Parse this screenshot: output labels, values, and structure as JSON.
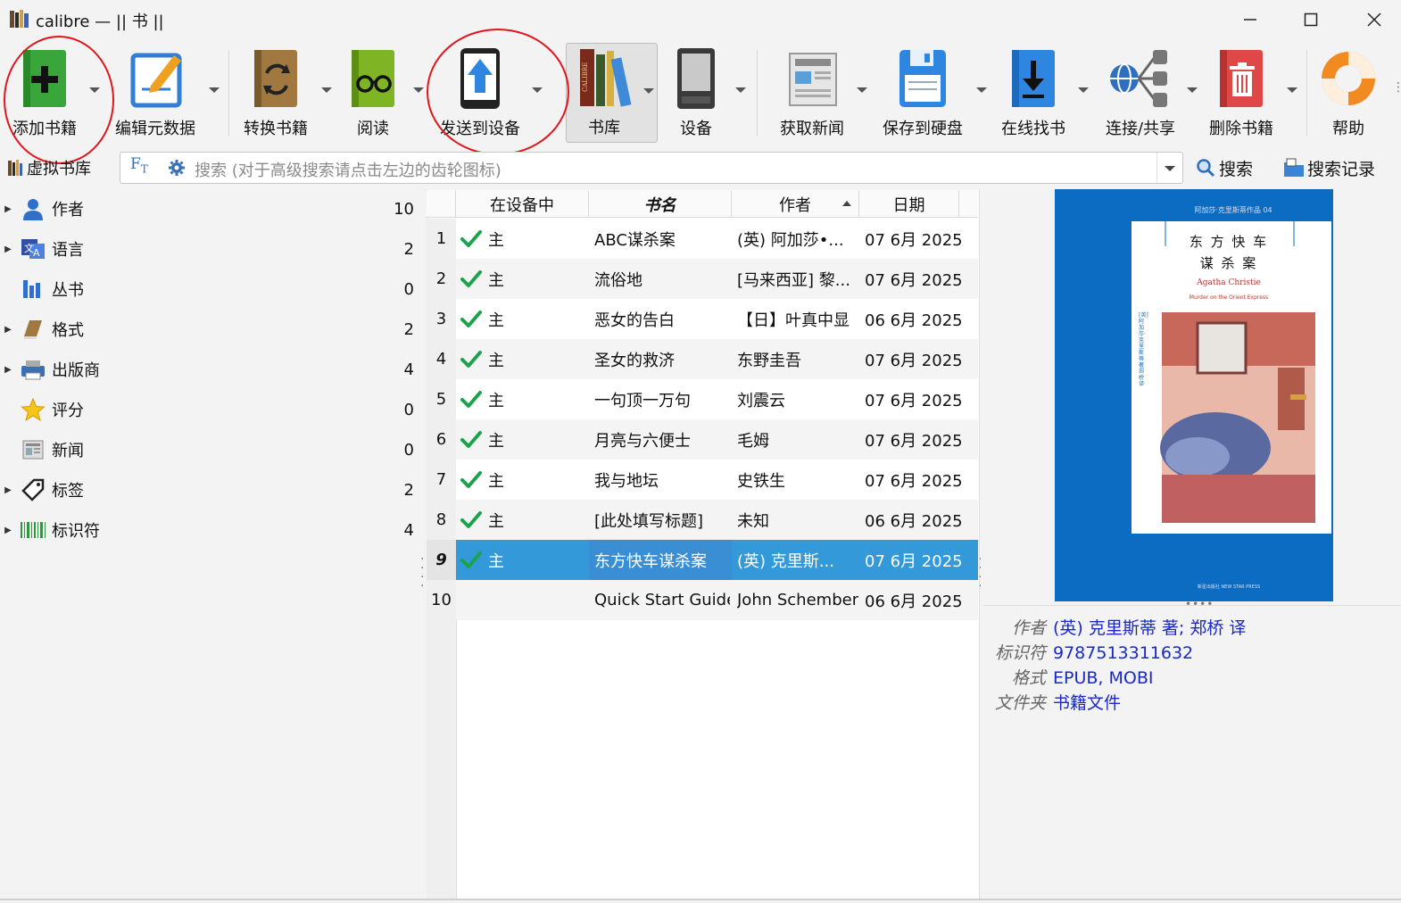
{
  "window": {
    "title": "calibre — || 书 ||"
  },
  "toolbar": {
    "add_books": "添加书籍",
    "edit_metadata": "编辑元数据",
    "convert_books": "转换书籍",
    "view": "阅读",
    "send_to_device": "发送到设备",
    "library": "书库",
    "device": "设备",
    "fetch_news": "获取新闻",
    "save_to_disk": "保存到硬盘",
    "get_books": "在线找书",
    "connect_share": "连接/共享",
    "remove_books": "删除书籍",
    "help": "帮助"
  },
  "searchbar": {
    "virtual_library": "虚拟书库",
    "placeholder": "搜索 (对于高级搜索请点击左边的齿轮图标)",
    "search_button": "搜索",
    "history_button": "搜索记录"
  },
  "tag_browser": [
    {
      "label": "作者",
      "count": "10",
      "icon": "person-icon",
      "expandable": true
    },
    {
      "label": "语言",
      "count": "2",
      "icon": "language-icon",
      "expandable": true
    },
    {
      "label": "丛书",
      "count": "0",
      "icon": "series-icon",
      "expandable": false
    },
    {
      "label": "格式",
      "count": "2",
      "icon": "book-format-icon",
      "expandable": true
    },
    {
      "label": "出版商",
      "count": "4",
      "icon": "publisher-icon",
      "expandable": true
    },
    {
      "label": "评分",
      "count": "0",
      "icon": "star-icon",
      "expandable": false
    },
    {
      "label": "新闻",
      "count": "0",
      "icon": "news-icon",
      "expandable": false
    },
    {
      "label": "标签",
      "count": "2",
      "icon": "tag-icon",
      "expandable": true
    },
    {
      "label": "标识符",
      "count": "4",
      "icon": "barcode-icon",
      "expandable": true
    }
  ],
  "table": {
    "headers": {
      "on_device": "在设备中",
      "title": "书名",
      "author": "作者",
      "date": "日期"
    },
    "rows": [
      {
        "num": "1",
        "on_device": "主",
        "title": "ABC谋杀案",
        "author": "(英) 阿加莎•...",
        "date": "07 6月 2025",
        "checked": true
      },
      {
        "num": "2",
        "on_device": "主",
        "title": "流俗地",
        "author": "[马来西亚] 黎...",
        "date": "07 6月 2025",
        "checked": true
      },
      {
        "num": "3",
        "on_device": "主",
        "title": "恶女的告白",
        "author": "【日】叶真中显",
        "date": "06 6月 2025",
        "checked": true
      },
      {
        "num": "4",
        "on_device": "主",
        "title": "圣女的救济",
        "author": "东野圭吾",
        "date": "07 6月 2025",
        "checked": true
      },
      {
        "num": "5",
        "on_device": "主",
        "title": "一句顶一万句",
        "author": "刘震云",
        "date": "07 6月 2025",
        "checked": true
      },
      {
        "num": "6",
        "on_device": "主",
        "title": "月亮与六便士",
        "author": "毛姆",
        "date": "07 6月 2025",
        "checked": true
      },
      {
        "num": "7",
        "on_device": "主",
        "title": "我与地坛",
        "author": "史铁生",
        "date": "07 6月 2025",
        "checked": true
      },
      {
        "num": "8",
        "on_device": "主",
        "title": "[此处填写标题]",
        "author": "未知",
        "date": "06 6月 2025",
        "checked": true
      },
      {
        "num": "9",
        "on_device": "主",
        "title": "东方快车谋杀案",
        "author": "(英) 克里斯...",
        "date": "07 6月 2025",
        "checked": true,
        "selected": true
      },
      {
        "num": "10",
        "on_device": "",
        "title": "Quick Start Guide",
        "author": "John Schember",
        "date": "06 6月 2025",
        "checked": false
      }
    ]
  },
  "cover": {
    "series_line": "阿加莎·克里斯蒂作品 04",
    "title_line1": "东 方 快 车",
    "title_line2": "谋  杀  案",
    "author_en": "Agatha Christie",
    "subtitle_en": "Murder on the Orient Express",
    "side_text": "[英] 阿加莎·克里斯蒂 著 郑桥 译",
    "publisher": "新星出版社 NEW STAR PRESS"
  },
  "details": {
    "author_key": "作者",
    "author_val": "(英) 克里斯蒂 著; 郑桥 译",
    "id_key": "标识符",
    "id_val": "9787513311632",
    "format_key": "格式",
    "format_val": "EPUB, MOBI",
    "folder_key": "文件夹",
    "folder_val": "书籍文件"
  },
  "colors": {
    "selection": "#3399d8",
    "check_green": "#1aa34a",
    "annotation_red": "#e0161b",
    "link_blue": "#1a28c7",
    "cover_blue": "#0b6cc2"
  }
}
